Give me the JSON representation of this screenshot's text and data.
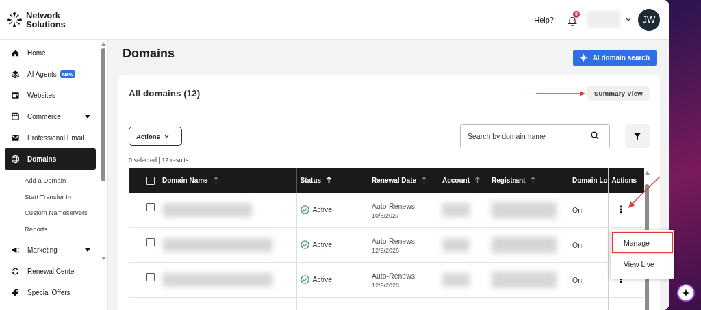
{
  "brand": {
    "name": "Network Solutions"
  },
  "header": {
    "help": "Help?",
    "notification_count": "9",
    "avatar_initials": "JW"
  },
  "sidebar": {
    "items": [
      {
        "label": "Home",
        "selected": false,
        "collapsible": false
      },
      {
        "label": "AI Agents",
        "selected": false,
        "collapsible": false,
        "badge": "New"
      },
      {
        "label": "Websites",
        "selected": false,
        "collapsible": false
      },
      {
        "label": "Commerce",
        "selected": false,
        "collapsible": true
      },
      {
        "label": "Professional Email",
        "selected": false,
        "collapsible": false
      },
      {
        "label": "Domains",
        "selected": true,
        "collapsible": false,
        "children": [
          {
            "label": "Add a Domain"
          },
          {
            "label": "Start Transfer In"
          },
          {
            "label": "Custom Nameservers"
          },
          {
            "label": "Reports"
          }
        ]
      },
      {
        "label": "Marketing",
        "selected": false,
        "collapsible": true
      },
      {
        "label": "Renewal Center",
        "selected": false,
        "collapsible": false
      },
      {
        "label": "Special Offers",
        "selected": false,
        "collapsible": false
      }
    ]
  },
  "page": {
    "title": "Domains",
    "ai_button": "AI domain search"
  },
  "card": {
    "heading": "All domains (12)",
    "summary_button": "Summary View",
    "actions_button": "Actions",
    "search": {
      "placeholder": "Search by domain name"
    },
    "result_text": "0 selected | 12 results"
  },
  "table": {
    "select_all_checked": false,
    "columns": [
      {
        "label": "Domain Name",
        "sortable": true,
        "sorted": false
      },
      {
        "label": "Status",
        "sortable": true,
        "sorted": true
      },
      {
        "label": "Renewal Date",
        "sortable": true,
        "sorted": false
      },
      {
        "label": "Account",
        "sortable": true,
        "sorted": false
      },
      {
        "label": "Registrant",
        "sortable": true,
        "sorted": false
      },
      {
        "label": "Domain Lo"
      },
      {
        "label": "Actions",
        "sortable": false
      }
    ],
    "rows": [
      {
        "checked": false,
        "status": "Active",
        "renewal": "Auto-Renews",
        "renewal_date": "10/8/2027",
        "domain_lock": "On"
      },
      {
        "checked": false,
        "status": "Active",
        "renewal": "Auto-Renews",
        "renewal_date": "12/9/2026",
        "domain_lock": "On"
      },
      {
        "checked": false,
        "status": "Active",
        "renewal": "Auto-Renews",
        "renewal_date": "12/9/2028",
        "domain_lock": "On"
      }
    ]
  },
  "row_menu": {
    "items": [
      {
        "label": "Manage",
        "outlined": true
      },
      {
        "label": "View Live",
        "outlined": false
      }
    ]
  }
}
